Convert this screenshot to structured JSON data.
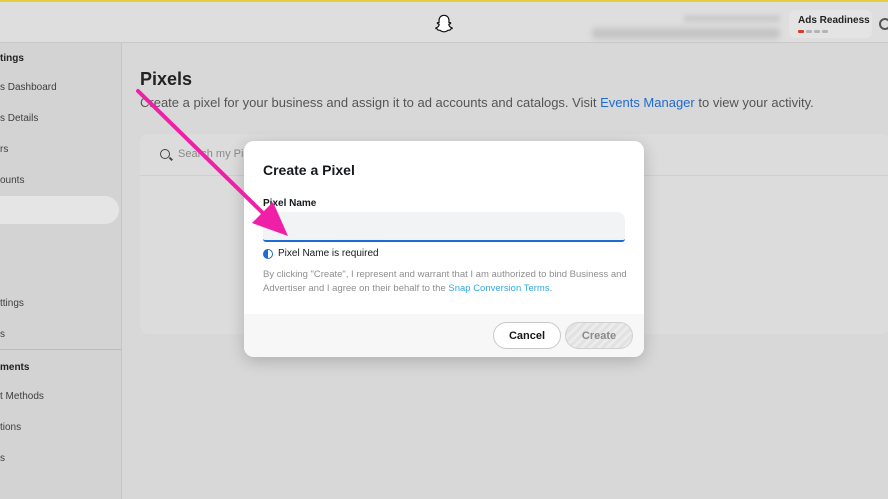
{
  "header": {
    "ads_readiness_label": "Ads Readiness"
  },
  "sidebar": {
    "items": [
      {
        "label": "tings",
        "header": true
      },
      {
        "label": "s Dashboard"
      },
      {
        "label": "s Details"
      },
      {
        "label": "rs"
      },
      {
        "label": "ounts"
      },
      {
        "label": ""
      },
      {
        "label": "ttings"
      },
      {
        "label": "s"
      },
      {
        "label": "ments",
        "header": true
      },
      {
        "label": "t Methods"
      },
      {
        "label": "tions"
      },
      {
        "label": "s"
      }
    ]
  },
  "main": {
    "title": "Pixels",
    "description_prefix": "Create a pixel for your business and assign it to ad accounts and catalogs. Visit ",
    "description_link": "Events Manager",
    "description_suffix": " to view your activity.",
    "search_placeholder": "Search my Pi"
  },
  "modal": {
    "title": "Create a Pixel",
    "field_label": "Pixel Name",
    "input_value": "",
    "validation_message": "Pixel Name is required",
    "legal_text": "By clicking \"Create\", I represent and warrant that I am authorized to bind Business and Advertiser and I agree on their behalf to the ",
    "legal_link": "Snap Conversion Terms",
    "legal_end": ".",
    "cancel_label": "Cancel",
    "create_label": "Create"
  },
  "colors": {
    "accent": "#1e6bd1",
    "annotation_arrow": "#f01fa8",
    "top_border": "#e6cf3f"
  }
}
